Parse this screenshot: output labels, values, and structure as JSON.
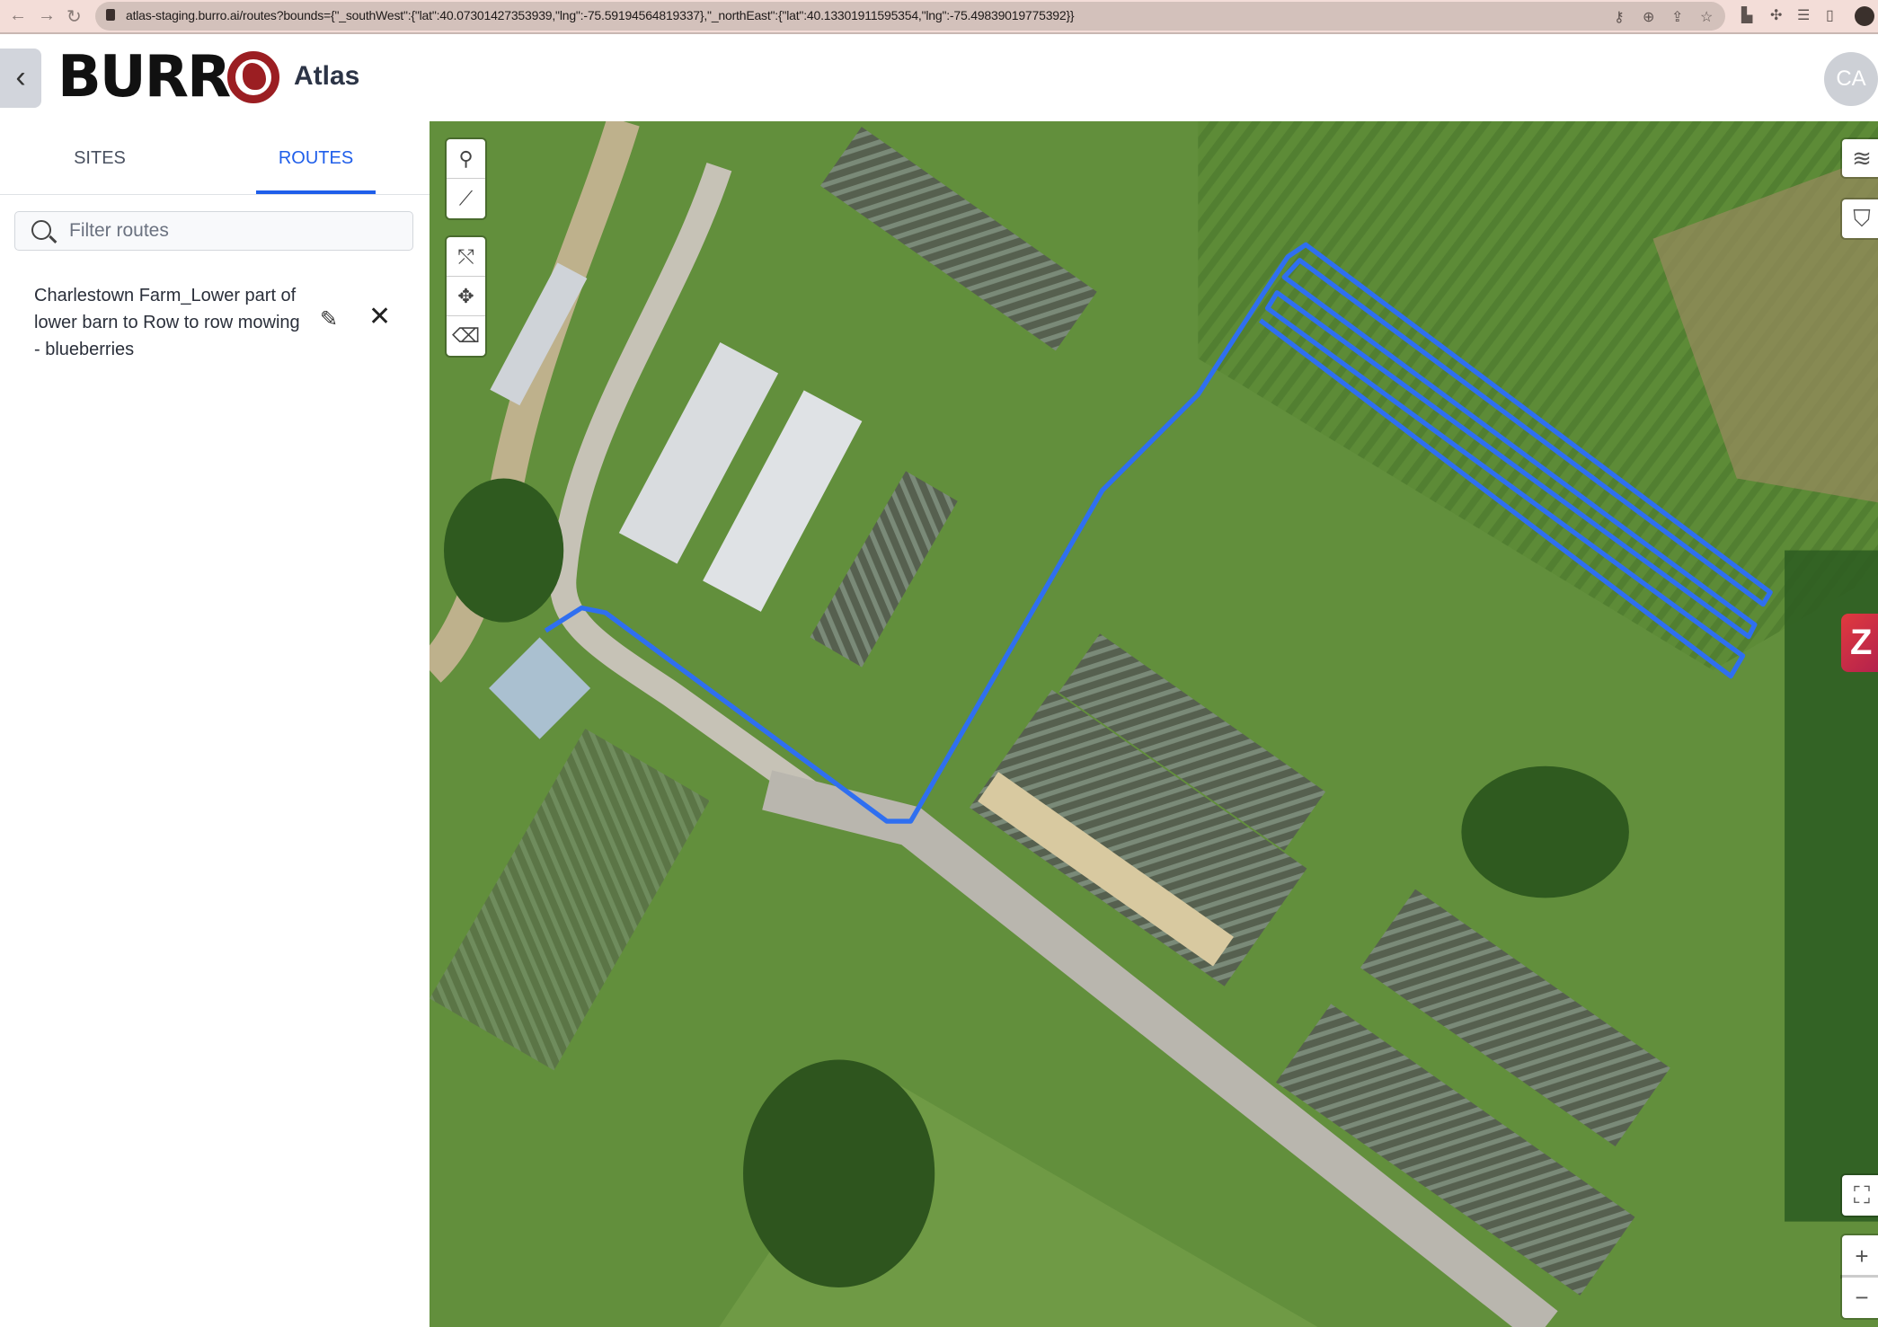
{
  "browser": {
    "url": "atlas-staging.burro.ai/routes?bounds={\"_southWest\":{\"lat\":40.07301427353939,\"lng\":-75.59194564819337},\"_northEast\":{\"lat\":40.13301911595354,\"lng\":-75.49839019775392}}"
  },
  "header": {
    "logo_text": "BURRO",
    "app_name": "Atlas",
    "avatar_initials": "CA"
  },
  "tabs": [
    {
      "label": "SITES"
    },
    {
      "label": "ROUTES"
    }
  ],
  "search": {
    "placeholder": "Filter routes",
    "value": ""
  },
  "routes": [
    {
      "name": "Charlestown Farm_Lower part of lower barn to Row to row mowing - blueberries"
    }
  ],
  "map_controls": {
    "zoom_in": "+",
    "zoom_out": "−",
    "badge": "Z"
  },
  "colors": {
    "accent": "#1f5eea",
    "route": "#2f6ff0",
    "brand": "#9b1e22"
  }
}
